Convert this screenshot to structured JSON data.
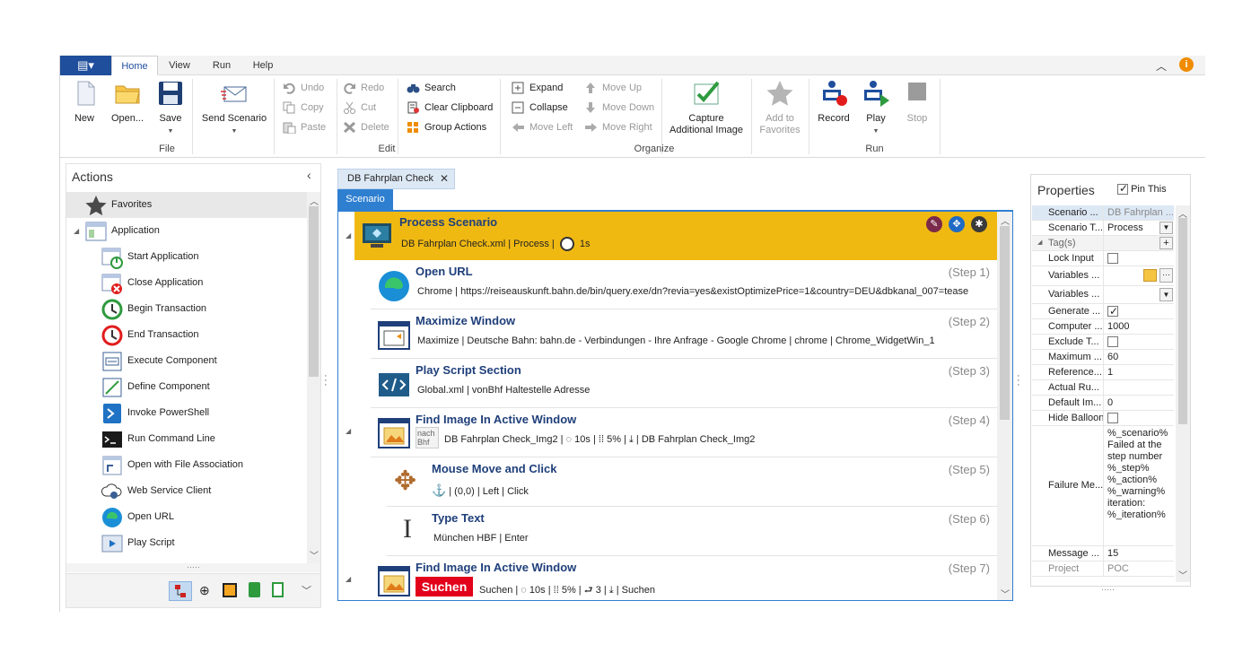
{
  "ribbon": {
    "tabs": [
      "Home",
      "View",
      "Run",
      "Help"
    ],
    "active_tab": "Home",
    "file": {
      "new": "New",
      "open": "Open...",
      "save": "Save",
      "send_scenario": "Send Scenario",
      "group": "File"
    },
    "edit": {
      "undo": "Undo",
      "redo": "Redo",
      "copy": "Copy",
      "cut": "Cut",
      "paste": "Paste",
      "delete": "Delete",
      "search": "Search",
      "clear_clipboard": "Clear Clipboard",
      "group_actions": "Group Actions",
      "group": "Edit"
    },
    "organize": {
      "expand": "Expand",
      "collapse": "Collapse",
      "move_left": "Move Left",
      "move_up": "Move Up",
      "move_down": "Move Down",
      "move_right": "Move Right",
      "capture_line1": "Capture",
      "capture_line2": "Additional Image",
      "favorites_line1": "Add to",
      "favorites_line2": "Favorites",
      "group": "Organize"
    },
    "run": {
      "record": "Record",
      "play": "Play",
      "stop": "Stop",
      "group": "Run"
    }
  },
  "actions_panel": {
    "title": "Actions",
    "items": [
      {
        "label": "Favorites",
        "icon": "star-icon"
      },
      {
        "label": "Application",
        "icon": "application-icon"
      },
      {
        "label": "Start Application",
        "icon": "start-application-icon"
      },
      {
        "label": "Close Application",
        "icon": "close-application-icon"
      },
      {
        "label": "Begin Transaction",
        "icon": "begin-transaction-icon"
      },
      {
        "label": "End Transaction",
        "icon": "end-transaction-icon"
      },
      {
        "label": "Execute Component",
        "icon": "execute-component-icon"
      },
      {
        "label": "Define Component",
        "icon": "define-component-icon"
      },
      {
        "label": "Invoke PowerShell",
        "icon": "powershell-icon"
      },
      {
        "label": "Run Command Line",
        "icon": "command-line-icon"
      },
      {
        "label": "Open with File Association",
        "icon": "file-association-icon"
      },
      {
        "label": "Web Service Client",
        "icon": "web-service-icon"
      },
      {
        "label": "Open URL",
        "icon": "edge-icon"
      },
      {
        "label": "Play Script",
        "icon": "play-script-icon"
      }
    ]
  },
  "document": {
    "tab": "DB Fahrplan Check",
    "subtab": "Scenario",
    "header": {
      "title": "Process Scenario",
      "desc": "DB Fahrplan Check.xml | Process |",
      "duration": "1s"
    },
    "steps": [
      {
        "title": "Open URL",
        "num": "(Step 1)",
        "desc": "Chrome | https://reiseauskunft.bahn.de/bin/query.exe/dn?revia=yes&existOptimizePrice=1&country=DEU&dbkanal_007=tease"
      },
      {
        "title": "Maximize Window",
        "num": "(Step 2)",
        "desc": "Maximize | Deutsche Bahn: bahn.de - Verbindungen - Ihre Anfrage - Google Chrome | chrome | Chrome_WidgetWin_1"
      },
      {
        "title": "Play Script Section",
        "num": "(Step 3)",
        "desc": "Global.xml | vonBhf Haltestelle Adresse"
      },
      {
        "title": "Find Image In Active Window",
        "num": "(Step 4)",
        "thumb": "nach Bhf",
        "desc_a": "DB Fahrplan Check_Img2 |",
        "timeout": "10s",
        "percent": "5%",
        "desc_b": "| DB Fahrplan Check_Img2"
      },
      {
        "title": "Mouse Move and Click",
        "num": "(Step 5)",
        "desc": "| (0,0) | Left | Click"
      },
      {
        "title": "Type Text",
        "num": "(Step 6)",
        "desc": "München HBF | Enter"
      },
      {
        "title": "Find Image In Active Window",
        "num": "(Step 7)",
        "thumb": "Suchen",
        "desc_a": "Suchen |",
        "timeout": "10s",
        "percent": "5%",
        "count": "3",
        "desc_b": "Suchen"
      }
    ]
  },
  "properties": {
    "title": "Properties",
    "pin_label": "Pin This",
    "rows": [
      {
        "k": "Scenario ...",
        "v": "DB Fahrplan ..."
      },
      {
        "k": "Scenario T...",
        "v": "Process"
      },
      {
        "k": "Tag(s)",
        "v": ""
      },
      {
        "k": "Lock Input",
        "v": ""
      },
      {
        "k": "Variables ...",
        "v": ""
      },
      {
        "k": "Variables ...",
        "v": ""
      },
      {
        "k": "Generate ...",
        "v": ""
      },
      {
        "k": "Computer ...",
        "v": "1000"
      },
      {
        "k": "Exclude T...",
        "v": ""
      },
      {
        "k": "Maximum ...",
        "v": "60"
      },
      {
        "k": "Reference...",
        "v": "1"
      },
      {
        "k": "Actual Ru...",
        "v": ""
      },
      {
        "k": "Default Im...",
        "v": "0"
      },
      {
        "k": "Hide Balloon",
        "v": ""
      },
      {
        "k": "Failure Me...",
        "v": "%_scenario% Failed at the step number %_step% %_action% %_warning% iteration: %_iteration%"
      },
      {
        "k": "Message ...",
        "v": "15"
      },
      {
        "k": "Project",
        "v": "POC"
      }
    ]
  },
  "colors": {
    "accent": "#2f7fd1",
    "header_bg": "#f0b912",
    "title_blue": "#1f3f7a",
    "file_btn": "#1f4e9c",
    "info": "#f08c00"
  }
}
